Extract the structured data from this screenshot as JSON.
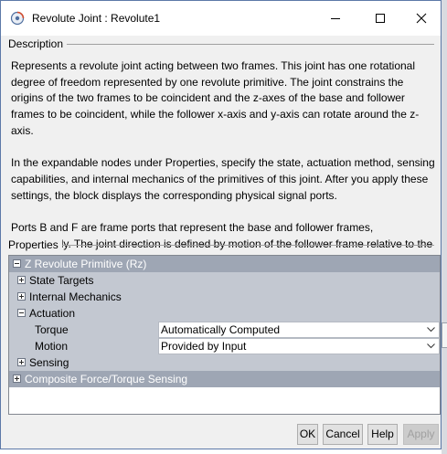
{
  "window": {
    "title": "Revolute Joint : Revolute1"
  },
  "description": {
    "heading": "Description",
    "paragraphs": [
      "Represents a revolute joint acting between two frames. This joint has one rotational degree of freedom represented by one revolute primitive. The joint constrains the origins of the two frames to be coincident and the z-axes of the base and follower frames to be coincident, while the follower x-axis and y-axis can rotate around the z-axis.",
      "In the expandable nodes under Properties, specify the state, actuation method, sensing capabilities, and internal mechanics of the primitives of this joint. After you apply these settings, the block displays the corresponding physical signal ports.",
      "Ports B and F are frame ports that represent the base and follower frames, respectively. The joint direction is defined by motion of the follower frame relative to the base frame."
    ]
  },
  "properties": {
    "heading": "Properties",
    "primitive_group": {
      "label": "Z Revolute Primitive (Rz)",
      "expanded": true
    },
    "state_targets": {
      "label": "State Targets",
      "expanded": false
    },
    "internal_mechanics": {
      "label": "Internal Mechanics",
      "expanded": false
    },
    "actuation": {
      "label": "Actuation",
      "expanded": true,
      "torque": {
        "name": "Torque",
        "value": "Automatically Computed"
      },
      "motion": {
        "name": "Motion",
        "value": "Provided by Input"
      }
    },
    "sensing": {
      "label": "Sensing",
      "expanded": false
    },
    "composite_sensing": {
      "label": "Composite Force/Torque Sensing",
      "expanded": false
    }
  },
  "buttons": {
    "ok": "OK",
    "cancel": "Cancel",
    "help": "Help",
    "apply": "Apply"
  },
  "colors": {
    "group_header": "#9ea6b4",
    "subgroup_row": "#c3c8d1",
    "dialog_bg": "#f0f0f0",
    "border_accent": "#5c79a8"
  },
  "icons": [
    "app-icon",
    "minimize-icon",
    "maximize-icon",
    "close-icon",
    "collapse-icon",
    "expand-icon",
    "chevron-down-icon"
  ]
}
